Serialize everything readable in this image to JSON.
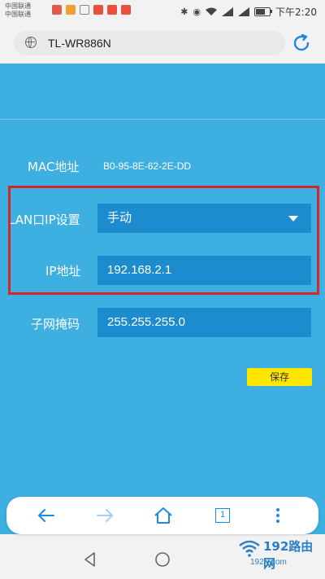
{
  "status_bar": {
    "carrier_1": "中国联通",
    "carrier_2": "中国联通",
    "time": "下午2:20",
    "battery_level": 0.7,
    "icons": [
      "bluetooth-icon",
      "eye-icon",
      "wifi-icon",
      "signal-4g-icon",
      "signal-icon",
      "battery-icon"
    ]
  },
  "browser": {
    "address": "TL-WR886N"
  },
  "form": {
    "mac_label": "MAC地址",
    "mac_value": "B0-95-8E-62-2E-DD",
    "lan_label": "LAN口IP设置",
    "lan_mode": "手动",
    "ip_label": "IP地址",
    "ip_value": "192.168.2.1",
    "mask_label": "子网掩码",
    "mask_value": "255.255.255.0",
    "save_label": "保存"
  },
  "toolbar": {
    "tab_count": "1",
    "icons": [
      "back-arrow-icon",
      "forward-arrow-icon",
      "home-icon",
      "tabs-icon",
      "more-icon"
    ]
  },
  "watermark": {
    "title": "192路由网",
    "url": "192ly.com"
  },
  "colors": {
    "content_bg": "#3dafe0",
    "field_bg": "#1d8ccf",
    "highlight": "#d6262a",
    "save_bg": "#ffe600"
  }
}
